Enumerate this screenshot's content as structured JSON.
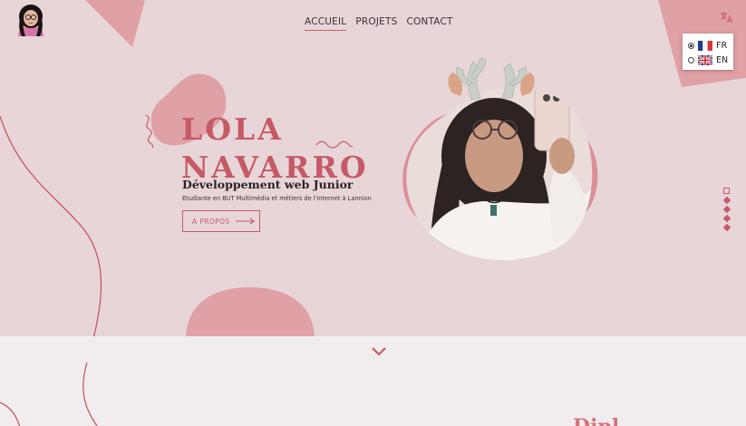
{
  "nav": {
    "items": [
      {
        "label": "ACCUEIL",
        "active": true
      },
      {
        "label": "PROJETS",
        "active": false
      },
      {
        "label": "CONTACT",
        "active": false
      }
    ]
  },
  "language": {
    "options": [
      {
        "code": "FR",
        "checked": true
      },
      {
        "code": "EN",
        "checked": false
      }
    ]
  },
  "hero": {
    "name_line1": "LOLA",
    "name_line2": "NAVARRO",
    "role": "Développement web Junior",
    "description": "Etudiante en BUT Multimédia et métiers de l'internet à Lannion",
    "about_button": "A PROPOS"
  },
  "bottom": {
    "heading": "Dipl"
  },
  "colors": {
    "accent": "#c55a66",
    "hero_bg": "#e8d5d8",
    "shape": "#dfa0a6",
    "lower_bg": "#f1edee"
  }
}
